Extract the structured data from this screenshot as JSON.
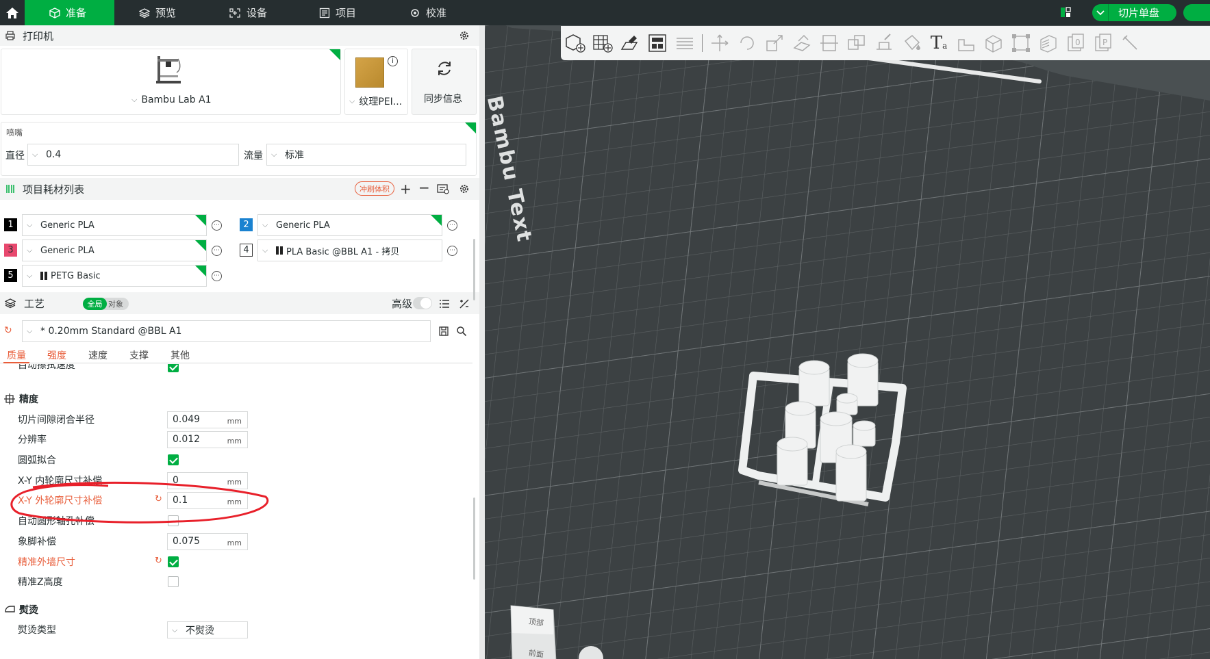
{
  "topbar": {
    "tabs": [
      {
        "label": "准备",
        "icon": "cube-icon"
      },
      {
        "label": "预览",
        "icon": "layers-icon"
      },
      {
        "label": "设备",
        "icon": "device-icon"
      },
      {
        "label": "项目",
        "icon": "project-icon"
      },
      {
        "label": "校准",
        "icon": "calibrate-icon"
      }
    ],
    "slice_label": "切片单盘"
  },
  "printer": {
    "section_title": "打印机",
    "name": "Bambu Lab A1",
    "plate": "纹理PEI...",
    "sync_label": "同步信息"
  },
  "nozzle": {
    "title": "喷嘴",
    "diameter_label": "直径",
    "diameter_value": "0.4",
    "flow_label": "流量",
    "flow_value": "标准"
  },
  "filaments": {
    "section_title": "项目耗材列表",
    "flush_label": "冲刷体积",
    "items": [
      {
        "num": "1",
        "name": "Generic PLA",
        "color": "#000000",
        "text_color": "#ffffff"
      },
      {
        "num": "2",
        "name": "Generic PLA",
        "color": "#1a82d0",
        "text_color": "#ffffff"
      },
      {
        "num": "3",
        "name": "Generic PLA",
        "color": "#e8486e",
        "text_color": "#262e30"
      },
      {
        "num": "4",
        "name": "PLA Basic @BBL A1 - 拷贝",
        "color": "#ffffff",
        "text_color": "#262e30"
      },
      {
        "num": "5",
        "name": "PETG Basic",
        "color": "#000000",
        "text_color": "#ffffff"
      }
    ]
  },
  "process": {
    "section_title": "工艺",
    "toggle_global": "全局",
    "toggle_object": "对象",
    "advanced_label": "高级",
    "preset": "* 0.20mm Standard @BBL A1",
    "tabs": [
      "质量",
      "强度",
      "速度",
      "支撑",
      "其他"
    ],
    "clipped_row": "自动擦拭速度",
    "precision_title": "精度",
    "rows": [
      {
        "label": "切片间隙闭合半径",
        "value": "0.049",
        "unit": "mm"
      },
      {
        "label": "分辨率",
        "value": "0.012",
        "unit": "mm"
      },
      {
        "label": "圆弧拟合",
        "checked": true
      },
      {
        "label": "X-Y 内轮廓尺寸补偿",
        "value": "0",
        "unit": "mm"
      },
      {
        "label": "X-Y 外轮廓尺寸补偿",
        "value": "0.1",
        "unit": "mm"
      },
      {
        "label": "自动圆形轴孔补偿",
        "checked": false
      },
      {
        "label": "象脚补偿",
        "value": "0.075",
        "unit": "mm"
      },
      {
        "label": "精准外墙尺寸",
        "checked": true
      },
      {
        "label": "精准Z高度",
        "checked": false
      }
    ],
    "ironing_title": "熨烫",
    "ironing_type_label": "熨烫类型",
    "ironing_type_value": "不熨烫"
  },
  "viewport": {
    "plate_text": "Bambu Text",
    "cube_top": "顶部",
    "cube_front": "前面"
  },
  "colors": {
    "accent": "#00ae42",
    "modified": "#e85d3a",
    "topbar": "#262e30",
    "canvas": "#3c4143"
  }
}
